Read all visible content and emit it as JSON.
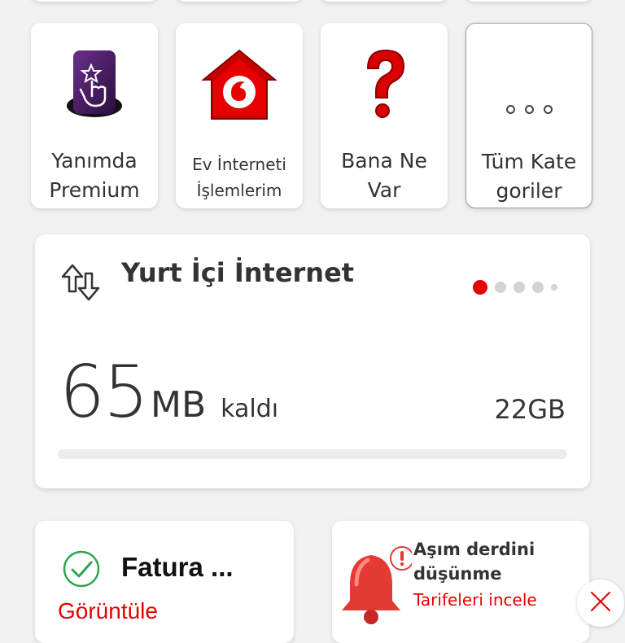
{
  "quick_actions": [
    {
      "label_line1": "Yanımda",
      "label_line2": "Premium",
      "icon": "premium-touch-icon"
    },
    {
      "label_line1": "Ev İnterneti",
      "label_line2": "İşlemlerim",
      "icon": "vodafone-home-icon"
    },
    {
      "label_line1": "Bana Ne",
      "label_line2": "Var",
      "icon": "question-mark-icon"
    },
    {
      "label_line1": "Tüm Kate",
      "label_line2": "goriler",
      "icon": "more-dots-icon"
    }
  ],
  "internet_card": {
    "title": "Yurt İçi İnternet",
    "remaining_value": "65",
    "remaining_unit": "MB",
    "remaining_suffix": "kaldı",
    "total": "22GB",
    "usage_remaining_fraction": 0.003,
    "pager_count": 5,
    "pager_active_index": 0
  },
  "bill_card": {
    "title": "Fatura ...",
    "action": "Görüntüle"
  },
  "overuse_card": {
    "title": "Aşım derdini düşünme",
    "link": "Tarifeleri incele"
  },
  "colors": {
    "accent": "#e60000",
    "success": "#2ea44f",
    "background": "#f2f1f2"
  }
}
